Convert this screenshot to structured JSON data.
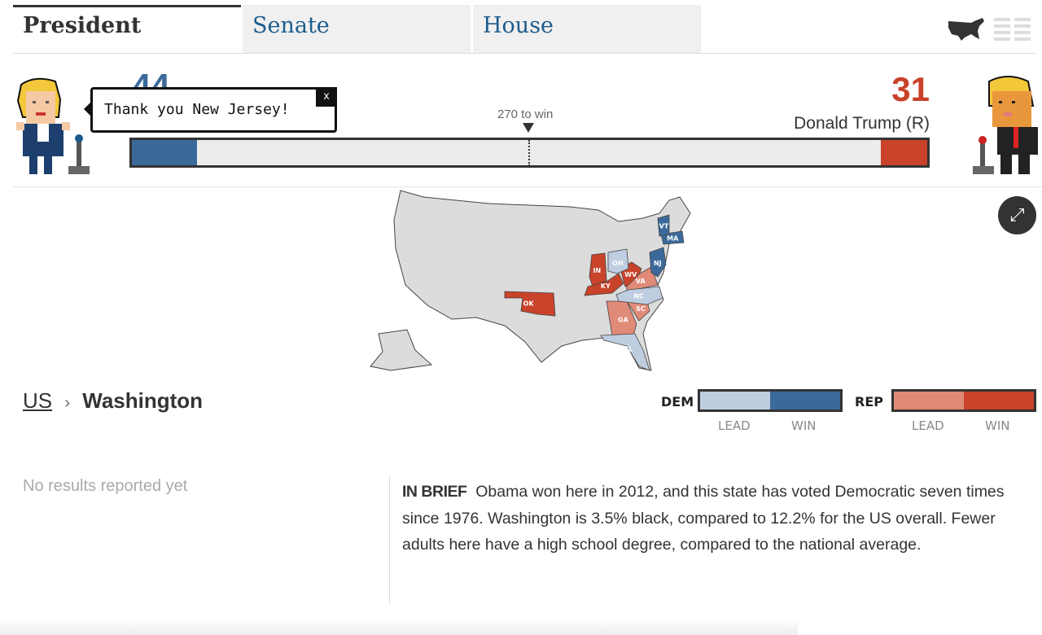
{
  "tabs": [
    {
      "label": "President",
      "active": true
    },
    {
      "label": "Senate"
    },
    {
      "label": "House"
    }
  ],
  "view_icons": [
    "us-map-icon",
    "list-grid-icon"
  ],
  "speech_bubble": {
    "text": "Thank you New Jersey!",
    "close": "x"
  },
  "dem": {
    "votes": "44",
    "color": "#3b6a9a",
    "fill_fraction": 0.082
  },
  "rep": {
    "votes": "31",
    "name": "Donald Trump (R)",
    "color": "#c8432a",
    "fill_fraction": 0.058
  },
  "threshold_label": "270 to win",
  "map": {
    "states": [
      {
        "abbr": "IN",
        "status": "rep-win"
      },
      {
        "abbr": "KY",
        "status": "rep-win"
      },
      {
        "abbr": "WV",
        "status": "rep-win"
      },
      {
        "abbr": "OK",
        "status": "rep-win"
      },
      {
        "abbr": "VA",
        "status": "rep-lead"
      },
      {
        "abbr": "SC",
        "status": "rep-lead"
      },
      {
        "abbr": "GA",
        "status": "rep-lead"
      },
      {
        "abbr": "OH",
        "status": "dem-lead"
      },
      {
        "abbr": "NC",
        "status": "dem-lead"
      },
      {
        "abbr": "FL",
        "status": "dem-lead"
      },
      {
        "abbr": "NJ",
        "status": "dem-win"
      },
      {
        "abbr": "MA",
        "status": "dem-win"
      },
      {
        "abbr": "VT",
        "status": "dem-win"
      }
    ],
    "colors": {
      "dem-lead": "#bfcde0",
      "dem-win": "#3b6a9a",
      "rep-lead": "#e08a78",
      "rep-win": "#c8432a",
      "none": "#dcdcdc"
    }
  },
  "breadcrumb": {
    "root": "US",
    "separator": "›",
    "current": "Washington"
  },
  "legend": {
    "dem": "DEM",
    "rep": "REP",
    "lead": "LEAD",
    "win": "WIN"
  },
  "results_status": "No results reported yet",
  "brief": {
    "label": "IN BRIEF",
    "text": "Obama won here in 2012, and this state has voted Democratic seven times since 1976. Washington is 3.5% black, compared to 12.2% for the US overall. Fewer adults here have a high school degree, compared to the national average."
  }
}
